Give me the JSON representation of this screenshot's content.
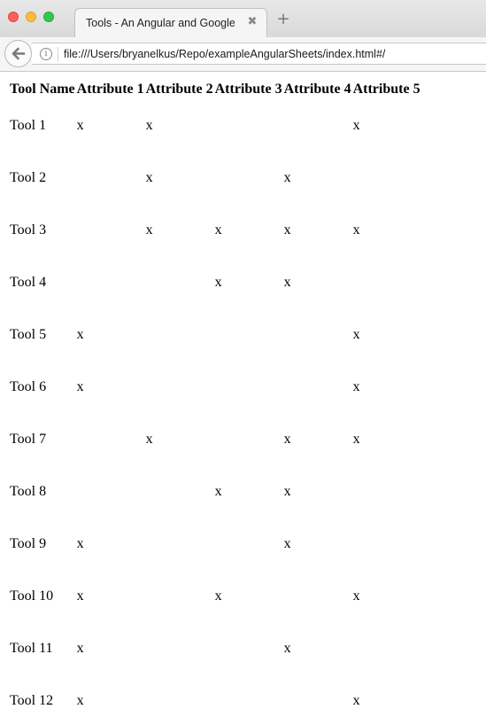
{
  "browser": {
    "tab_title": "Tools - An Angular and Google ...",
    "tab_close_glyph": "✖",
    "new_tab_glyph": "+",
    "url": "file:///Users/bryanelkus/Repo/exampleAngularSheets/index.html#/",
    "info_glyph": "i"
  },
  "table": {
    "headers": [
      "Tool Name",
      "Attribute 1",
      "Attribute 2",
      "Attribute 3",
      "Attribute 4",
      "Attribute 5"
    ],
    "rows": [
      {
        "name": "Tool 1",
        "cells": [
          "x",
          "x",
          "",
          "",
          "x"
        ]
      },
      {
        "name": "Tool 2",
        "cells": [
          "",
          "x",
          "",
          "x",
          ""
        ]
      },
      {
        "name": "Tool 3",
        "cells": [
          "",
          "x",
          "x",
          "x",
          "x"
        ]
      },
      {
        "name": "Tool 4",
        "cells": [
          "",
          "",
          "x",
          "x",
          ""
        ]
      },
      {
        "name": "Tool 5",
        "cells": [
          "x",
          "",
          "",
          "",
          "x"
        ]
      },
      {
        "name": "Tool 6",
        "cells": [
          "x",
          "",
          "",
          "",
          "x"
        ]
      },
      {
        "name": "Tool 7",
        "cells": [
          "",
          "x",
          "",
          "x",
          "x"
        ]
      },
      {
        "name": "Tool 8",
        "cells": [
          "",
          "",
          "x",
          "x",
          ""
        ]
      },
      {
        "name": "Tool 9",
        "cells": [
          "x",
          "",
          "",
          "x",
          ""
        ]
      },
      {
        "name": "Tool 10",
        "cells": [
          "x",
          "",
          "x",
          "",
          "x"
        ]
      },
      {
        "name": "Tool 11",
        "cells": [
          "x",
          "",
          "",
          "x",
          ""
        ]
      },
      {
        "name": "Tool 12",
        "cells": [
          "x",
          "",
          "",
          "",
          "x"
        ]
      }
    ]
  },
  "colors": {
    "close_red": "#fc605b",
    "minimize_yellow": "#fdbc40",
    "zoom_green": "#34c84a"
  }
}
